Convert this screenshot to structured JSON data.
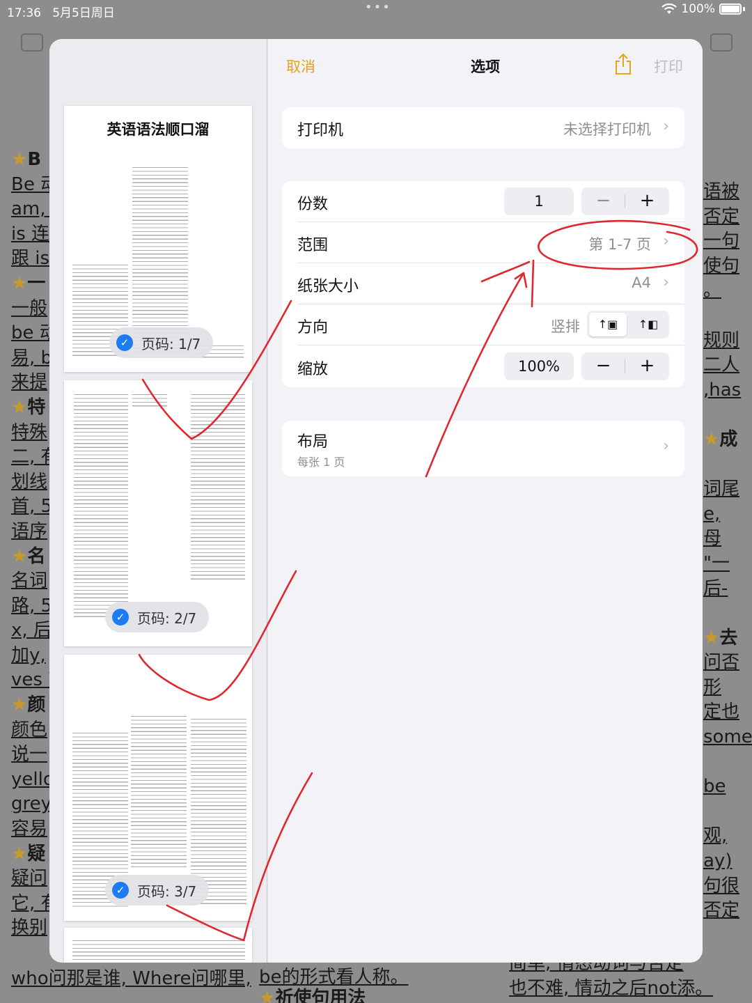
{
  "status_bar": {
    "time": "17:36",
    "date": "5月5日周日",
    "battery": "100%"
  },
  "background_doc": {
    "left_lines": [
      "B",
      "Be 动",
      "am, a",
      "is 连",
      "跟 is",
      "一",
      "一般",
      "be 动",
      "易, b",
      "来提",
      "特",
      "特殊",
      "二, 有",
      "划线",
      "首, 5",
      "语序",
      "名",
      "名词",
      "路, 5",
      "x, 后",
      "加y, ",
      "ves 就",
      "颜",
      "颜色",
      "说一",
      "yello",
      "grey",
      "容易",
      "疑",
      "疑问",
      "它, 有",
      "换别"
    ],
    "right_lines": [
      "语被",
      "否定",
      "一句",
      "使句",
      "。",
      "",
      "规则",
      "二人",
      ",has",
      "",
      "成",
      "",
      "词尾",
      "e, ",
      "母",
      "\"一",
      "后-",
      "",
      "去",
      "问否",
      "形",
      "定也",
      "some",
      "",
      " be",
      "",
      "观, ",
      "ay)",
      "句很",
      "否定"
    ],
    "bottom_left": "who问那是谁, Where问哪里,",
    "bottom_mid": "be的形式看人称。",
    "bottom_mid2": "祈使句用法",
    "bottom_right1": "简单, 情态动词与否定",
    "bottom_right2": "也不难, 情动之后not添。"
  },
  "preview": {
    "page1_title": "英语语法顺口溜",
    "badges": [
      "页码: 1/7",
      "页码: 2/7",
      "页码: 3/7"
    ]
  },
  "options": {
    "nav": {
      "cancel": "取消",
      "title": "选项",
      "print": "打印"
    },
    "printer": {
      "label": "打印机",
      "value": "未选择打印机"
    },
    "copies": {
      "label": "份数",
      "value": "1"
    },
    "range": {
      "label": "范围",
      "value": "第 1-7 页"
    },
    "paper": {
      "label": "纸张大小",
      "value": "A4"
    },
    "orientation": {
      "label": "方向",
      "value": "竖排"
    },
    "scale": {
      "label": "缩放",
      "value": "100%"
    },
    "layout": {
      "label": "布局",
      "sub": "每张 1 页"
    }
  },
  "colors": {
    "accent": "#e5a21c",
    "check": "#1d7cf2",
    "annotation": "#e0262e"
  }
}
